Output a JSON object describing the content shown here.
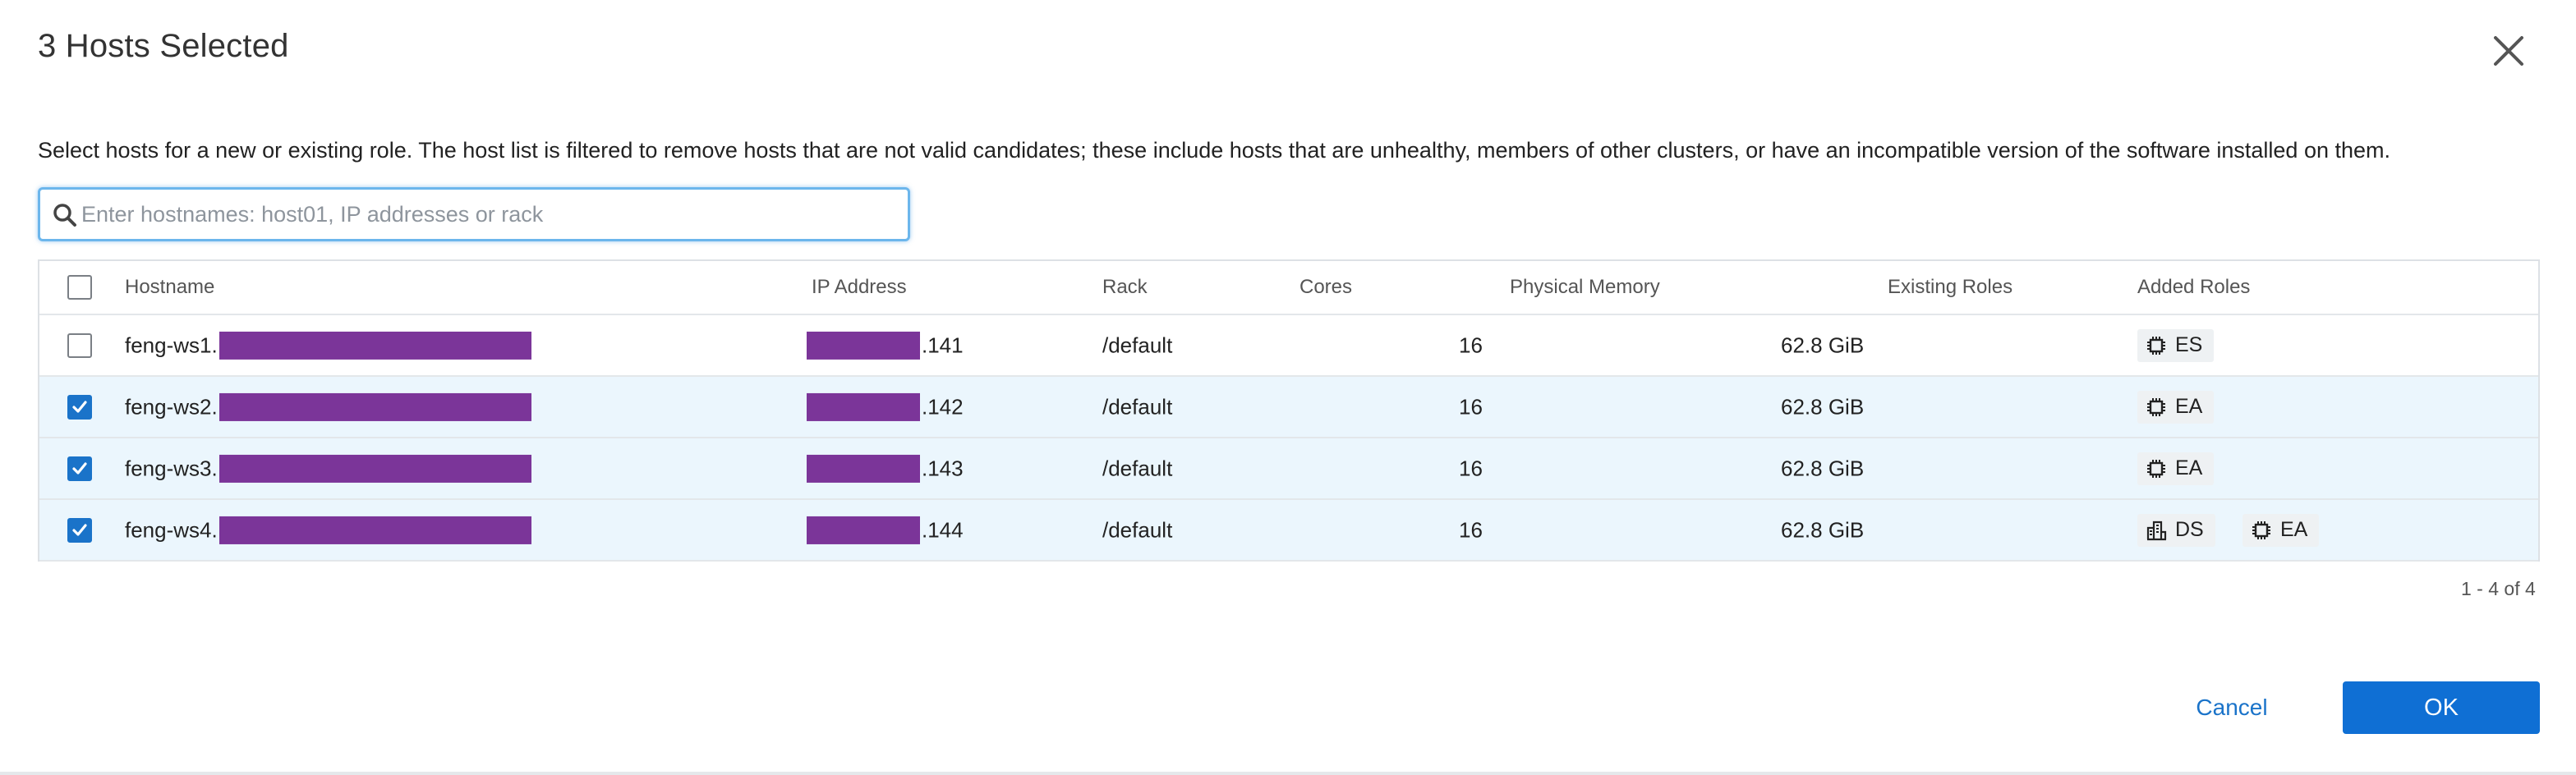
{
  "dialog": {
    "title": "3 Hosts Selected",
    "description": "Select hosts for a new or existing role. The host list is filtered to remove hosts that are not valid candidates; these include hosts that are unhealthy, members of other clusters, or have an incompatible version of the software installed on them.",
    "search": {
      "placeholder": "Enter hostnames: host01, IP addresses or rack",
      "value": ""
    },
    "columns": {
      "hostname": "Hostname",
      "ip": "IP Address",
      "rack": "Rack",
      "cores": "Cores",
      "memory": "Physical Memory",
      "existing": "Existing Roles",
      "added": "Added Roles"
    },
    "rows": [
      {
        "checked": false,
        "hostname": "feng-ws1.",
        "ip_suffix": ".141",
        "rack": "/default",
        "cores": "16",
        "memory": "62.8 GiB",
        "roles": [
          "ES"
        ]
      },
      {
        "checked": true,
        "hostname": "feng-ws2.",
        "ip_suffix": ".142",
        "rack": "/default",
        "cores": "16",
        "memory": "62.8 GiB",
        "roles": [
          "EA"
        ]
      },
      {
        "checked": true,
        "hostname": "feng-ws3.",
        "ip_suffix": ".143",
        "rack": "/default",
        "cores": "16",
        "memory": "62.8 GiB",
        "roles": [
          "EA"
        ]
      },
      {
        "checked": true,
        "hostname": "feng-ws4.",
        "ip_suffix": ".144",
        "rack": "/default",
        "cores": "16",
        "memory": "62.8 GiB",
        "roles": [
          "DS",
          "EA"
        ]
      }
    ],
    "role_icons": {
      "ES": "chip-icon",
      "EA": "chip-icon",
      "DS": "building-icon"
    },
    "pager": "1 - 4 of 4",
    "cancel_label": "Cancel",
    "ok_label": "OK",
    "colors": {
      "accent": "#0f6fd4",
      "selected_row": "#ebf6fd",
      "redaction": "#7b3599",
      "search_focus": "#6cb6ec"
    }
  }
}
